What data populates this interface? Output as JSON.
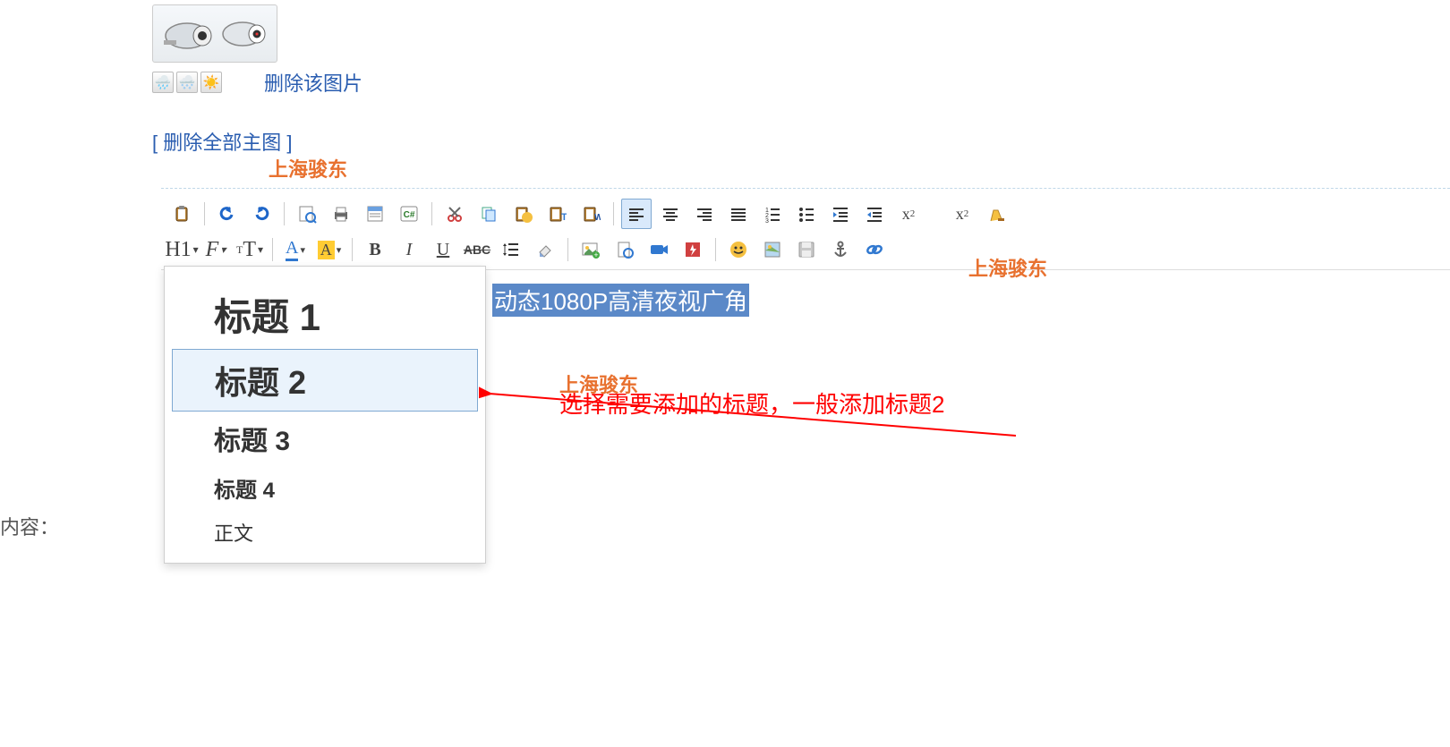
{
  "top": {
    "delete_this": "删除该图片",
    "delete_all": "[ 删除全部主图 ]"
  },
  "watermarks": {
    "w1": "上海骏东",
    "w2": "上海骏东",
    "w3": "上海骏东"
  },
  "toolbar": {
    "row1": [
      "paste",
      "undo",
      "redo",
      "preview",
      "print",
      "template",
      "source",
      "cut",
      "copy",
      "paste-word",
      "paste-text",
      "paste-html",
      "align-left",
      "align-center",
      "align-right",
      "align-justify",
      "ordered-list",
      "unordered-list",
      "indent",
      "outdent",
      "subscript",
      "superscript",
      "clear-format"
    ],
    "row2_labels": {
      "heading": "H1",
      "font": "F",
      "size": "T"
    }
  },
  "content": {
    "selected_text": "动态1080P高清夜视广角"
  },
  "heading_menu": {
    "items": [
      {
        "label": "标题 1",
        "cls": "dd-h1"
      },
      {
        "label": "标题 2",
        "cls": "dd-h2",
        "selected": true
      },
      {
        "label": "标题 3",
        "cls": "dd-h3"
      },
      {
        "label": "标题 4",
        "cls": "dd-h4"
      },
      {
        "label": "正文",
        "cls": "dd-body"
      }
    ]
  },
  "annotation": {
    "text": "选择需要添加的标题，一般添加标题2"
  },
  "side_label": "内容："
}
